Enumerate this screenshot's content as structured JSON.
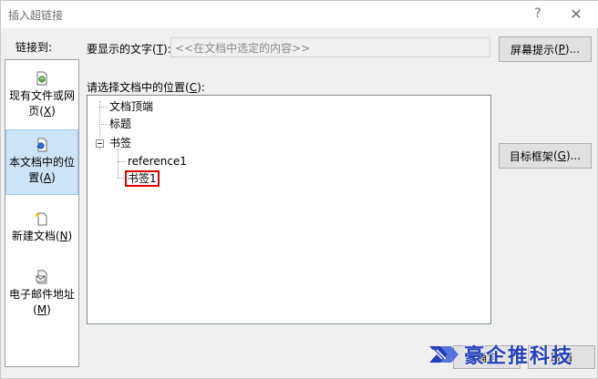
{
  "window": {
    "title": "插入超链接",
    "help_label": "?",
    "close_label": "✕"
  },
  "link_to": {
    "label_prefix": "链接到:",
    "items": [
      {
        "label": "现有文件或网页",
        "hotkey": "X",
        "icon": "web-page-icon",
        "selected": false
      },
      {
        "label": "本文档中的位置",
        "hotkey": "A",
        "icon": "document-place-icon",
        "selected": true
      },
      {
        "label": "新建文档",
        "hotkey": "N",
        "icon": "new-document-icon",
        "selected": false
      },
      {
        "label": "电子邮件地址",
        "hotkey": "M",
        "icon": "email-icon",
        "selected": false
      }
    ]
  },
  "display_text": {
    "label": "要显示的文字",
    "hotkey": "T",
    "value": "<<在文档中选定的内容>>"
  },
  "screentip_button": {
    "label": "屏幕提示",
    "hotkey": "P"
  },
  "place_select": {
    "label": "请选择文档中的位置",
    "hotkey": "C",
    "tree": [
      {
        "label": "文档顶端"
      },
      {
        "label": "标题"
      },
      {
        "label": "书签",
        "expanded": true,
        "children": [
          {
            "label": "reference1"
          },
          {
            "label": "书签1",
            "highlighted": true
          }
        ]
      }
    ]
  },
  "target_frame_button": {
    "label": "目标框架",
    "hotkey": "G"
  },
  "ok_button": {
    "label": "确定"
  },
  "cancel_button": {
    "label": "取消"
  },
  "watermark": {
    "text": "豪企推科技",
    "icon": "brand-logo-icon",
    "color": "#2340b8"
  }
}
